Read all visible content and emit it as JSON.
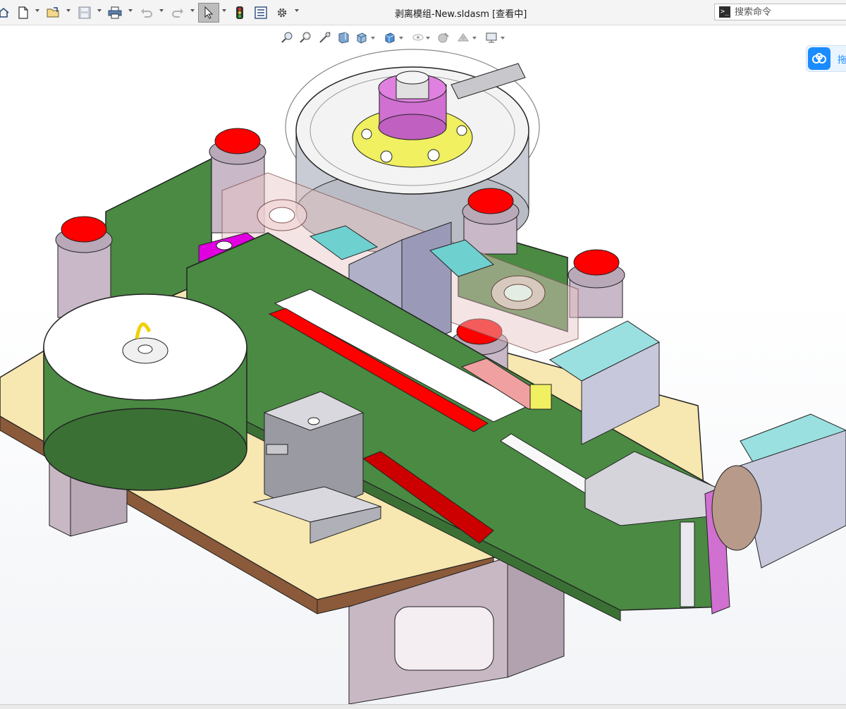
{
  "window": {
    "title": "剥离模组-New.sldasm [查看中]"
  },
  "toolbar": {
    "items": [
      {
        "name": "home-icon"
      },
      {
        "name": "new-document-icon"
      },
      {
        "name": "open-folder-icon"
      },
      {
        "name": "save-icon"
      },
      {
        "name": "print-icon"
      },
      {
        "name": "undo-icon"
      },
      {
        "name": "redo-icon"
      },
      {
        "name": "select-pointer-icon"
      },
      {
        "name": "traffic-light-icon"
      },
      {
        "name": "file-properties-icon"
      },
      {
        "name": "settings-gear-icon"
      }
    ]
  },
  "search": {
    "placeholder": "搜索命令"
  },
  "view_toolbar": {
    "items": [
      {
        "name": "zoom-to-fit-icon"
      },
      {
        "name": "zoom-to-area-icon"
      },
      {
        "name": "previous-view-icon"
      },
      {
        "name": "section-view-icon"
      },
      {
        "name": "view-orientation-icon"
      },
      {
        "name": "display-style-icon"
      },
      {
        "name": "hide-show-items-icon"
      },
      {
        "name": "edit-appearance-icon"
      },
      {
        "name": "apply-scene-icon"
      },
      {
        "name": "view-settings-icon"
      }
    ]
  },
  "side_tab": {
    "label": "拖"
  },
  "colors": {
    "base_plate": "#f7e7b0",
    "base_plate_edge": "#8a5a3a",
    "green_panel": "#4a8a43",
    "red_cap": "#ff0000",
    "magenta_part": "#e000e0",
    "cyan_part": "#6fd0d0",
    "yellow_part": "#f0f060",
    "steel": "#c8c8cc",
    "accent_blue": "#1a8cff"
  }
}
